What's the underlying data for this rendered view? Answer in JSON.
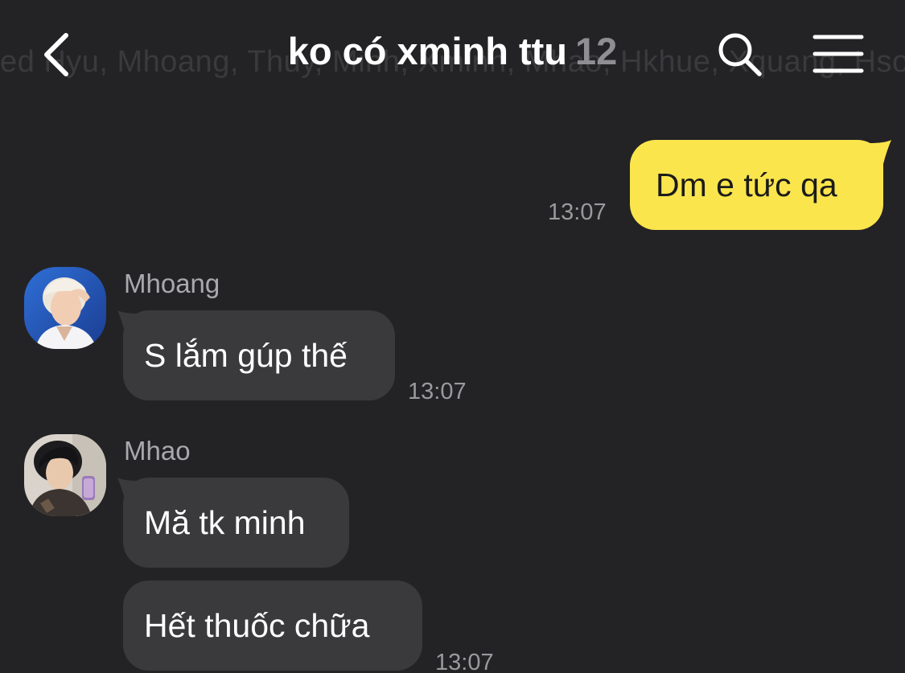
{
  "header": {
    "title": "ko có xminh ttu",
    "member_count": "12",
    "members_text": "ed Hyu, Mhoang, Thuy, Minh, Xminh, Mhao, Hkhue, Xquang, Hson"
  },
  "icons": {
    "back": "chevron-left-icon",
    "search": "search-icon",
    "menu": "hamburger-menu-icon"
  },
  "messages": {
    "m1": {
      "text": "Dm e tức qa",
      "time": "13:07"
    },
    "m2": {
      "sender": "Mhoang",
      "text": "S lắm gúp thế",
      "time": "13:07"
    },
    "m3": {
      "sender": "Mhao",
      "text1": "Mă tk minh",
      "text2": "Hết thuốc chữa",
      "time": "13:07"
    }
  },
  "colors": {
    "background": "#232325",
    "outgoing_bubble": "#fae54c",
    "incoming_bubble": "#3a3a3c",
    "timestamp": "#9a9a9e",
    "member_count": "#8e8e93"
  }
}
